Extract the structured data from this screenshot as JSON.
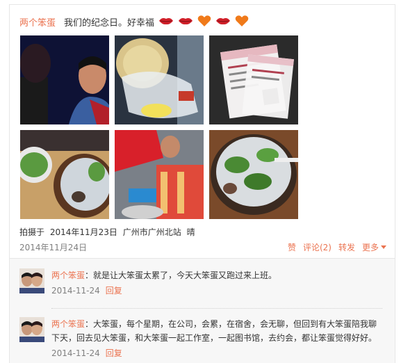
{
  "post": {
    "author": "两个笨蛋",
    "text": "我们的纪念日。好幸福",
    "emoticons": [
      "lips-icon",
      "lips-icon",
      "heart-icon",
      "lips-icon",
      "heart-icon"
    ],
    "photos": [
      {
        "label": "selfie-couple"
      },
      {
        "label": "food-bag"
      },
      {
        "label": "train-tickets"
      },
      {
        "label": "food-pot"
      },
      {
        "label": "eating-person"
      },
      {
        "label": "food-pot-closeup"
      }
    ],
    "meta": {
      "prefix": "拍摄于",
      "datetime": "2014年11月23日",
      "location": "广州市广州北站",
      "weather": "晴"
    },
    "date": "2014年11月24日",
    "actions": {
      "like": "赞",
      "comment": "评论(2)",
      "repost": "转发",
      "more": "更多"
    }
  },
  "comments": [
    {
      "name": "两个笨蛋",
      "text": "：就是让大笨蛋太累了，今天大笨蛋又跑过来上班。",
      "date": "2014-11-24",
      "reply": "回复"
    },
    {
      "name": "两个笨蛋",
      "text": "：大笨蛋，每个星期，在公司，会累，在宿舍，会无聊，但回到有大笨蛋陪我聊下天，回去见大笨蛋，和大笨蛋一起工作室，一起图书馆，去约会，都让笨蛋觉得好好。",
      "date": "2014-11-24",
      "reply": "回复"
    }
  ],
  "colors": {
    "accent": "#eb7350",
    "muted": "#808080",
    "border": "#e6e6e6",
    "comment_bg": "#f7f7f7"
  }
}
